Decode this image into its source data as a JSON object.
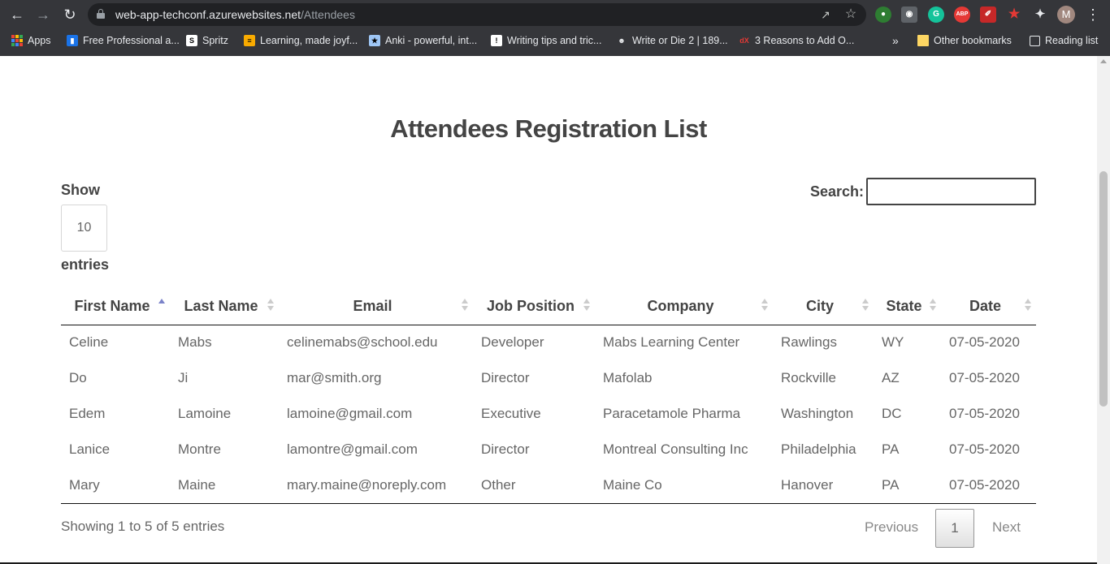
{
  "browser": {
    "url_host": "web-app-techconf.azurewebsites.net",
    "url_path": "/Attendees",
    "profile_initial": "M",
    "bookmarks": [
      {
        "label": "Apps",
        "icon": "apps-grid-icon"
      },
      {
        "label": "Free Professional a...",
        "icon": "bookmark-favicon"
      },
      {
        "label": "Spritz",
        "icon": "spritz-favicon"
      },
      {
        "label": "Learning, made joyf...",
        "icon": "learning-favicon"
      },
      {
        "label": "Anki - powerful, int...",
        "icon": "anki-favicon"
      },
      {
        "label": "Writing tips and tric...",
        "icon": "writing-favicon"
      },
      {
        "label": "Write or Die 2 | 189...",
        "icon": "writeordie-favicon"
      },
      {
        "label": "3 Reasons to Add O...",
        "icon": "edx-favicon"
      }
    ],
    "overflow_label": "»",
    "other_bookmarks": "Other bookmarks",
    "reading_list": "Reading list"
  },
  "page": {
    "title": "Attendees Registration List",
    "show_label": "Show",
    "page_length": "10",
    "entries_label": "entries",
    "search_label": "Search:",
    "search_value": "",
    "columns": [
      "First Name",
      "Last Name",
      "Email",
      "Job Position",
      "Company",
      "City",
      "State",
      "Date"
    ],
    "rows": [
      [
        "Celine",
        "Mabs",
        "celinemabs@school.edu",
        "Developer",
        "Mabs Learning Center",
        "Rawlings",
        "WY",
        "07-05-2020"
      ],
      [
        "Do",
        "Ji",
        "mar@smith.org",
        "Director",
        "Mafolab",
        "Rockville",
        "AZ",
        "07-05-2020"
      ],
      [
        "Edem",
        "Lamoine",
        "lamoine@gmail.com",
        "Executive",
        "Paracetamole Pharma",
        "Washington",
        "DC",
        "07-05-2020"
      ],
      [
        "Lanice",
        "Montre",
        "lamontre@gmail.com",
        "Director",
        "Montreal Consulting Inc",
        "Philadelphia",
        "PA",
        "07-05-2020"
      ],
      [
        "Mary",
        "Maine",
        "mary.maine@noreply.com",
        "Other",
        "Maine Co",
        "Hanover",
        "PA",
        "07-05-2020"
      ]
    ],
    "info": "Showing 1 to 5 of 5 entries",
    "pager": {
      "previous": "Previous",
      "current": "1",
      "next": "Next"
    },
    "sorted_column": "First Name",
    "sort_direction": "ascending"
  },
  "colors": {
    "heading": "#444444",
    "cell_text": "#666666",
    "sort_active": "#7b83c9",
    "chrome_bg": "#35363a"
  }
}
